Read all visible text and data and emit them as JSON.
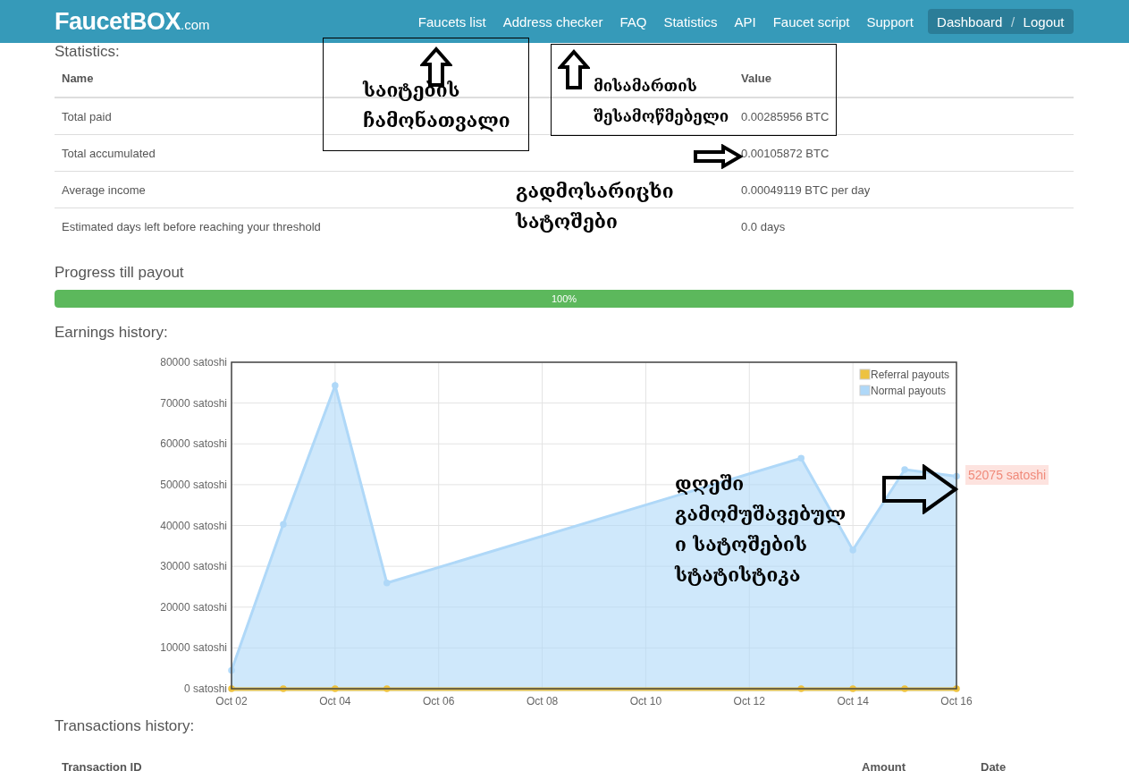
{
  "navbar": {
    "brand": "FaucetBOX",
    "brand_suffix": ".com",
    "links": [
      "Faucets list",
      "Address checker",
      "FAQ",
      "Statistics",
      "API",
      "Faucet script",
      "Support"
    ],
    "account": {
      "links": [
        "Dashboard",
        "Logout"
      ],
      "separator": "/"
    }
  },
  "statistics": {
    "title": "Statistics:",
    "columns": [
      "Name",
      "Value"
    ],
    "rows": [
      [
        "Total paid",
        "0.00285956 BTC"
      ],
      [
        "Total accumulated",
        "0.00105872 BTC"
      ],
      [
        "Average income",
        "0.00049119 BTC per day"
      ],
      [
        "Estimated days left before reaching your threshold",
        "0.0 days"
      ]
    ]
  },
  "progress": {
    "title": "Progress till payout",
    "level": 1.0,
    "label": "100%"
  },
  "earnings": {
    "title": "Earnings history:",
    "chart_data": {
      "type": "area",
      "categories": [
        "Oct 02",
        null,
        "Oct 04",
        null,
        "Oct 06",
        null,
        "Oct 08",
        null,
        "Oct 10",
        null,
        "Oct 12",
        null,
        "Oct 14",
        null,
        "Oct 16"
      ],
      "series": [
        {
          "name": "Referral payouts",
          "color": "#edc240",
          "values": [
            0,
            0,
            0,
            0,
            null,
            null,
            null,
            null,
            null,
            null,
            null,
            0,
            0,
            0,
            0
          ]
        },
        {
          "name": "Normal payouts",
          "color": "#afd8f8",
          "values": [
            4500,
            40300,
            74300,
            25900,
            null,
            null,
            null,
            null,
            null,
            null,
            null,
            56500,
            34000,
            53700,
            52075
          ]
        }
      ],
      "ylim": [
        0,
        80000
      ],
      "grid": true,
      "legend": "upper right",
      "yticks": [
        {
          "value": 0,
          "label": "0 satoshi"
        },
        {
          "value": 10000,
          "label": "10000 satoshi"
        },
        {
          "value": 20000,
          "label": "20000 satoshi"
        },
        {
          "value": 30000,
          "label": "30000 satoshi"
        },
        {
          "value": 40000,
          "label": "40000 satoshi"
        },
        {
          "value": 50000,
          "label": "50000 satoshi"
        },
        {
          "value": 60000,
          "label": "60000 satoshi"
        },
        {
          "value": 70000,
          "label": "70000 satoshi"
        },
        {
          "value": 80000,
          "label": "80000 satoshi"
        }
      ],
      "annotations": [
        {
          "x": "Oct 16",
          "y": 52075,
          "text": "52075 satoshi"
        }
      ]
    }
  },
  "transactions": {
    "title": "Transactions history:",
    "columns": [
      "Transaction ID",
      "Amount",
      "Date"
    ]
  },
  "annotations": [
    {
      "kind": "boxed",
      "text": "საიტების\nჩამონათვალი"
    },
    {
      "kind": "boxed",
      "text": "მისამართის\nშესამოწმებელი"
    },
    {
      "kind": "plain",
      "text": "გადმოსარიცხი\nსატოშები"
    },
    {
      "kind": "plain",
      "text": "დღეში\nგამომუშავებულ\nი სატოშების\nსტატისტიკა"
    }
  ]
}
